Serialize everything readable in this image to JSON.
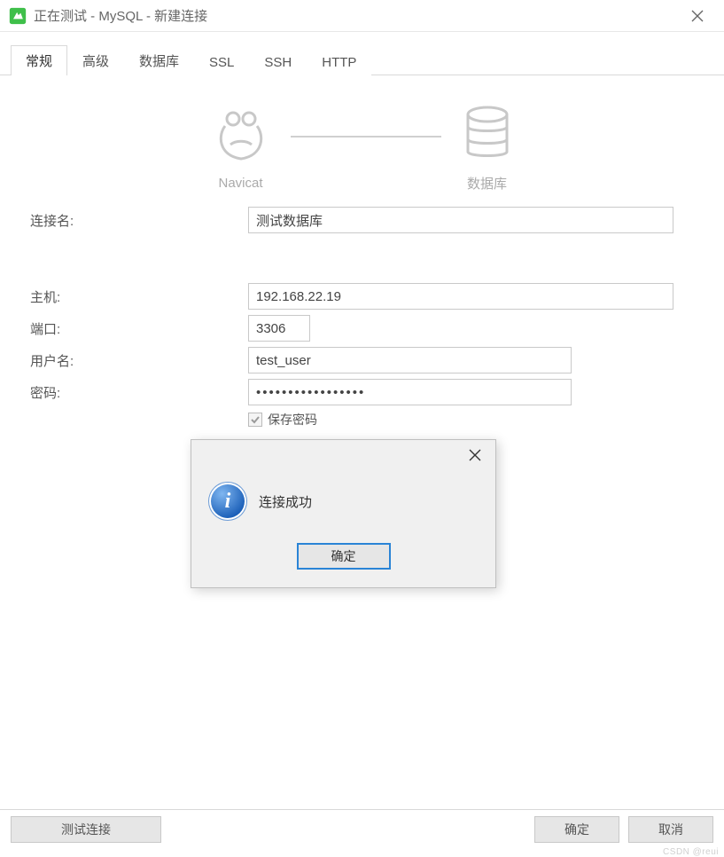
{
  "window": {
    "title": "正在测试 - MySQL - 新建连接"
  },
  "tabs": [
    {
      "label": "常规"
    },
    {
      "label": "高级"
    },
    {
      "label": "数据库"
    },
    {
      "label": "SSL"
    },
    {
      "label": "SSH"
    },
    {
      "label": "HTTP"
    }
  ],
  "diagram": {
    "left_label": "Navicat",
    "right_label": "数据库"
  },
  "form": {
    "connection_name_label": "连接名:",
    "connection_name_value": "测试数据库",
    "host_label": "主机:",
    "host_value": "192.168.22.19",
    "port_label": "端口:",
    "port_value": "3306",
    "username_label": "用户名:",
    "username_value": "test_user",
    "password_label": "密码:",
    "password_value": "•••••••••••••••••",
    "save_password_label": "保存密码",
    "save_password_checked": true
  },
  "buttons": {
    "test_connection": "测试连接",
    "ok": "确定",
    "cancel": "取消"
  },
  "modal": {
    "message": "连接成功",
    "ok": "确定"
  },
  "watermark": "CSDN @reui"
}
